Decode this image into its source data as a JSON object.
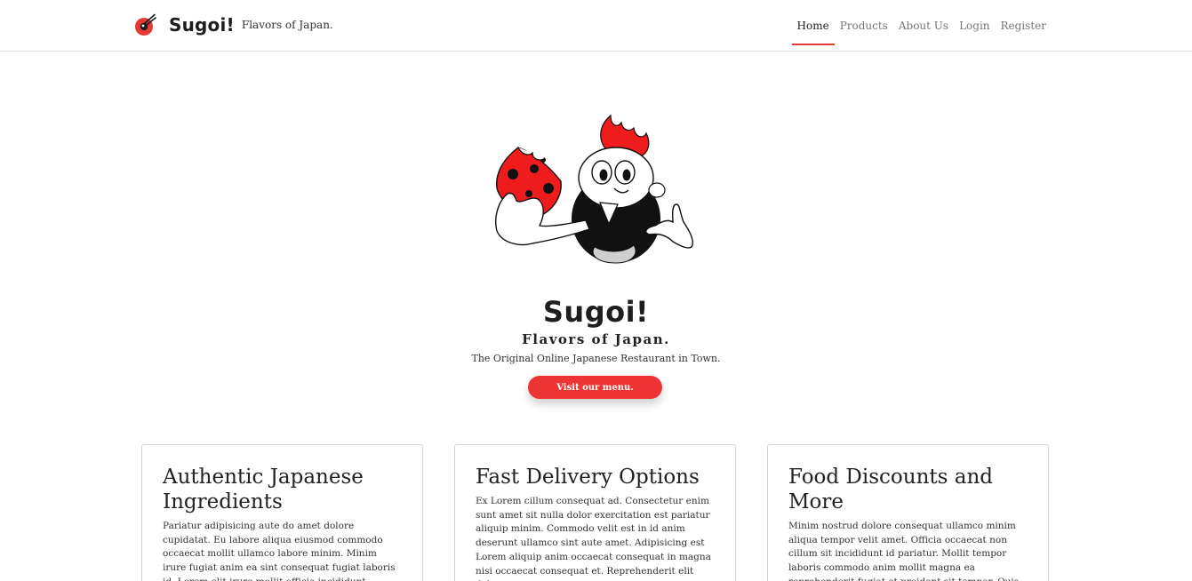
{
  "brand": {
    "name": "Sugoi!",
    "tagline": "Flavors of Japan.",
    "logo_icon": "bowl-chopsticks-icon"
  },
  "nav": {
    "items": [
      {
        "label": "Home",
        "active": true
      },
      {
        "label": "Products",
        "active": false
      },
      {
        "label": "About Us",
        "active": false
      },
      {
        "label": "Login",
        "active": false
      },
      {
        "label": "Register",
        "active": false
      }
    ]
  },
  "hero": {
    "illustration": "mascot-eating-icon",
    "title": "Sugoi!",
    "subtitle": "Flavors of Japan.",
    "description": "The Original Online Japanese Restaurant in Town.",
    "cta_label": "Visit our menu."
  },
  "cards": [
    {
      "title": "Authentic Japanese Ingredients",
      "body": "Pariatur adipisicing aute do amet dolore cupidatat. Eu labore aliqua eiusmod commodo occaecat mollit ullamco labore minim. Minim irure fugiat anim ea sint consequat fugiat laboris id. Lorem elit irure mollit officia incididunt ullamco dolore irure esse."
    },
    {
      "title": "Fast Delivery Options",
      "body": "Ex Lorem cillum consequat ad. Consectetur enim sunt amet sit nulla dolor exercitation est pariatur aliquip minim. Commodo velit est in id anim deserunt ullamco sint aute amet. Adipisicing est Lorem aliquip anim occaecat consequat in magna nisi occaecat consequat et. Reprehenderit elit dolore"
    },
    {
      "title": "Food Discounts and More",
      "body": "Minim nostrud dolore consequat ullamco minim aliqua tempor velit amet. Officia occaecat non cillum sit incididunt id pariatur. Mollit tempor laboris commodo anim mollit magna ea reprehenderit fugiat et proident sit tempor. Quis velit non dolore irure"
    }
  ],
  "colors": {
    "accent": "#ec3434",
    "text": "#222222",
    "muted": "#777777",
    "border": "#d6d6d6"
  }
}
